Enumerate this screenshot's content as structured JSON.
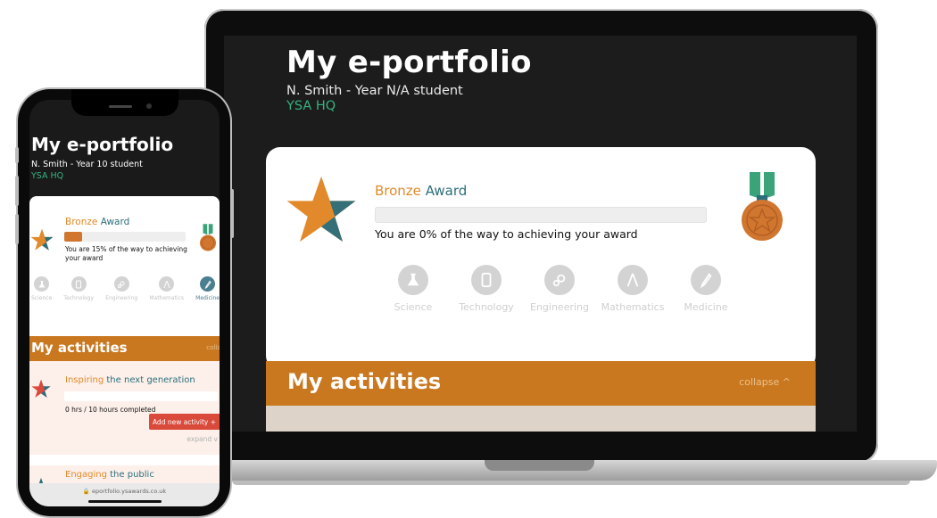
{
  "laptop": {
    "title": "My e-portfolio",
    "student": "N. Smith - Year N/A student",
    "organisation": "YSA HQ",
    "award": {
      "level_word": "Bronze",
      "award_word": "Award",
      "progress_percent": 0,
      "progress_text": "You are 0% of the way to achieving your award"
    },
    "subjects": [
      "Science",
      "Technology",
      "Engineering",
      "Mathematics",
      "Medicine"
    ],
    "activities_heading": "My activities",
    "collapse_label": "collapse ^"
  },
  "phone": {
    "title": "My e-portfolio",
    "student": "N. Smith - Year 10 student",
    "organisation": "YSA HQ",
    "award": {
      "level_word": "Bronze",
      "award_word": "Award",
      "progress_percent": 15,
      "progress_text": "You are 15% of the way to achieving your award"
    },
    "subjects": [
      "Science",
      "Technology",
      "Engineering",
      "Mathematics",
      "Medicine"
    ],
    "active_subject": "Medicine",
    "activities_heading": "My activities",
    "collapse_label": "collap",
    "activities": [
      {
        "title_accent": "Inspiring",
        "title_rest": "the next generation",
        "hours_text": "0 hrs / 10 hours completed",
        "add_button": "Add new activity +",
        "expand_label": "expand v"
      },
      {
        "title_accent": "Engaging",
        "title_rest": "the public"
      }
    ],
    "url": "🔒 eportfolio.ysawards.co.uk"
  },
  "colors": {
    "bronze": "#e28a2b",
    "teal": "#2b6e7b",
    "activities_bar": "#c97820",
    "org_green": "#36b37e",
    "add_button": "#d94a3b"
  }
}
